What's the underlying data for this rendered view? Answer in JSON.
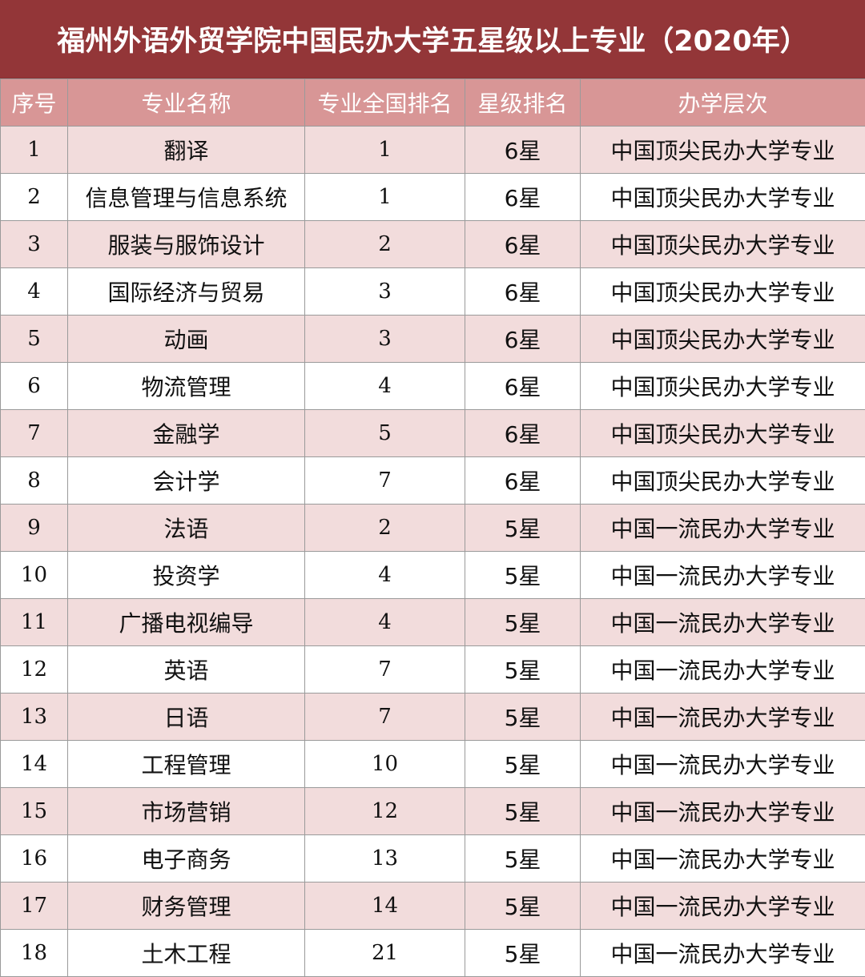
{
  "title": "福州外语外贸学院中国民办大学五星级以上专业（2020年）",
  "headers": [
    "序号",
    "专业名称",
    "专业全国排名",
    "星级排名",
    "办学层次"
  ],
  "rows": [
    {
      "no": "1",
      "major": "翻译",
      "rank": "1",
      "star": "6星",
      "level": "中国顶尖民办大学专业"
    },
    {
      "no": "2",
      "major": "信息管理与信息系统",
      "rank": "1",
      "star": "6星",
      "level": "中国顶尖民办大学专业"
    },
    {
      "no": "3",
      "major": "服装与服饰设计",
      "rank": "2",
      "star": "6星",
      "level": "中国顶尖民办大学专业"
    },
    {
      "no": "4",
      "major": "国际经济与贸易",
      "rank": "3",
      "star": "6星",
      "level": "中国顶尖民办大学专业"
    },
    {
      "no": "5",
      "major": "动画",
      "rank": "3",
      "star": "6星",
      "level": "中国顶尖民办大学专业"
    },
    {
      "no": "6",
      "major": "物流管理",
      "rank": "4",
      "star": "6星",
      "level": "中国顶尖民办大学专业"
    },
    {
      "no": "7",
      "major": "金融学",
      "rank": "5",
      "star": "6星",
      "level": "中国顶尖民办大学专业"
    },
    {
      "no": "8",
      "major": "会计学",
      "rank": "7",
      "star": "6星",
      "level": "中国顶尖民办大学专业"
    },
    {
      "no": "9",
      "major": "法语",
      "rank": "2",
      "star": "5星",
      "level": "中国一流民办大学专业"
    },
    {
      "no": "10",
      "major": "投资学",
      "rank": "4",
      "star": "5星",
      "level": "中国一流民办大学专业"
    },
    {
      "no": "11",
      "major": "广播电视编导",
      "rank": "4",
      "star": "5星",
      "level": "中国一流民办大学专业"
    },
    {
      "no": "12",
      "major": "英语",
      "rank": "7",
      "star": "5星",
      "level": "中国一流民办大学专业"
    },
    {
      "no": "13",
      "major": "日语",
      "rank": "7",
      "star": "5星",
      "level": "中国一流民办大学专业"
    },
    {
      "no": "14",
      "major": "工程管理",
      "rank": "10",
      "star": "5星",
      "level": "中国一流民办大学专业"
    },
    {
      "no": "15",
      "major": "市场营销",
      "rank": "12",
      "star": "5星",
      "level": "中国一流民办大学专业"
    },
    {
      "no": "16",
      "major": "电子商务",
      "rank": "13",
      "star": "5星",
      "level": "中国一流民办大学专业"
    },
    {
      "no": "17",
      "major": "财务管理",
      "rank": "14",
      "star": "5星",
      "level": "中国一流民办大学专业"
    },
    {
      "no": "18",
      "major": "土木工程",
      "rank": "21",
      "star": "5星",
      "level": "中国一流民办大学专业"
    }
  ],
  "colors": {
    "title_bg": "#933638",
    "header_bg": "#d89696",
    "row_alt_bg": "#f2dcdc"
  }
}
